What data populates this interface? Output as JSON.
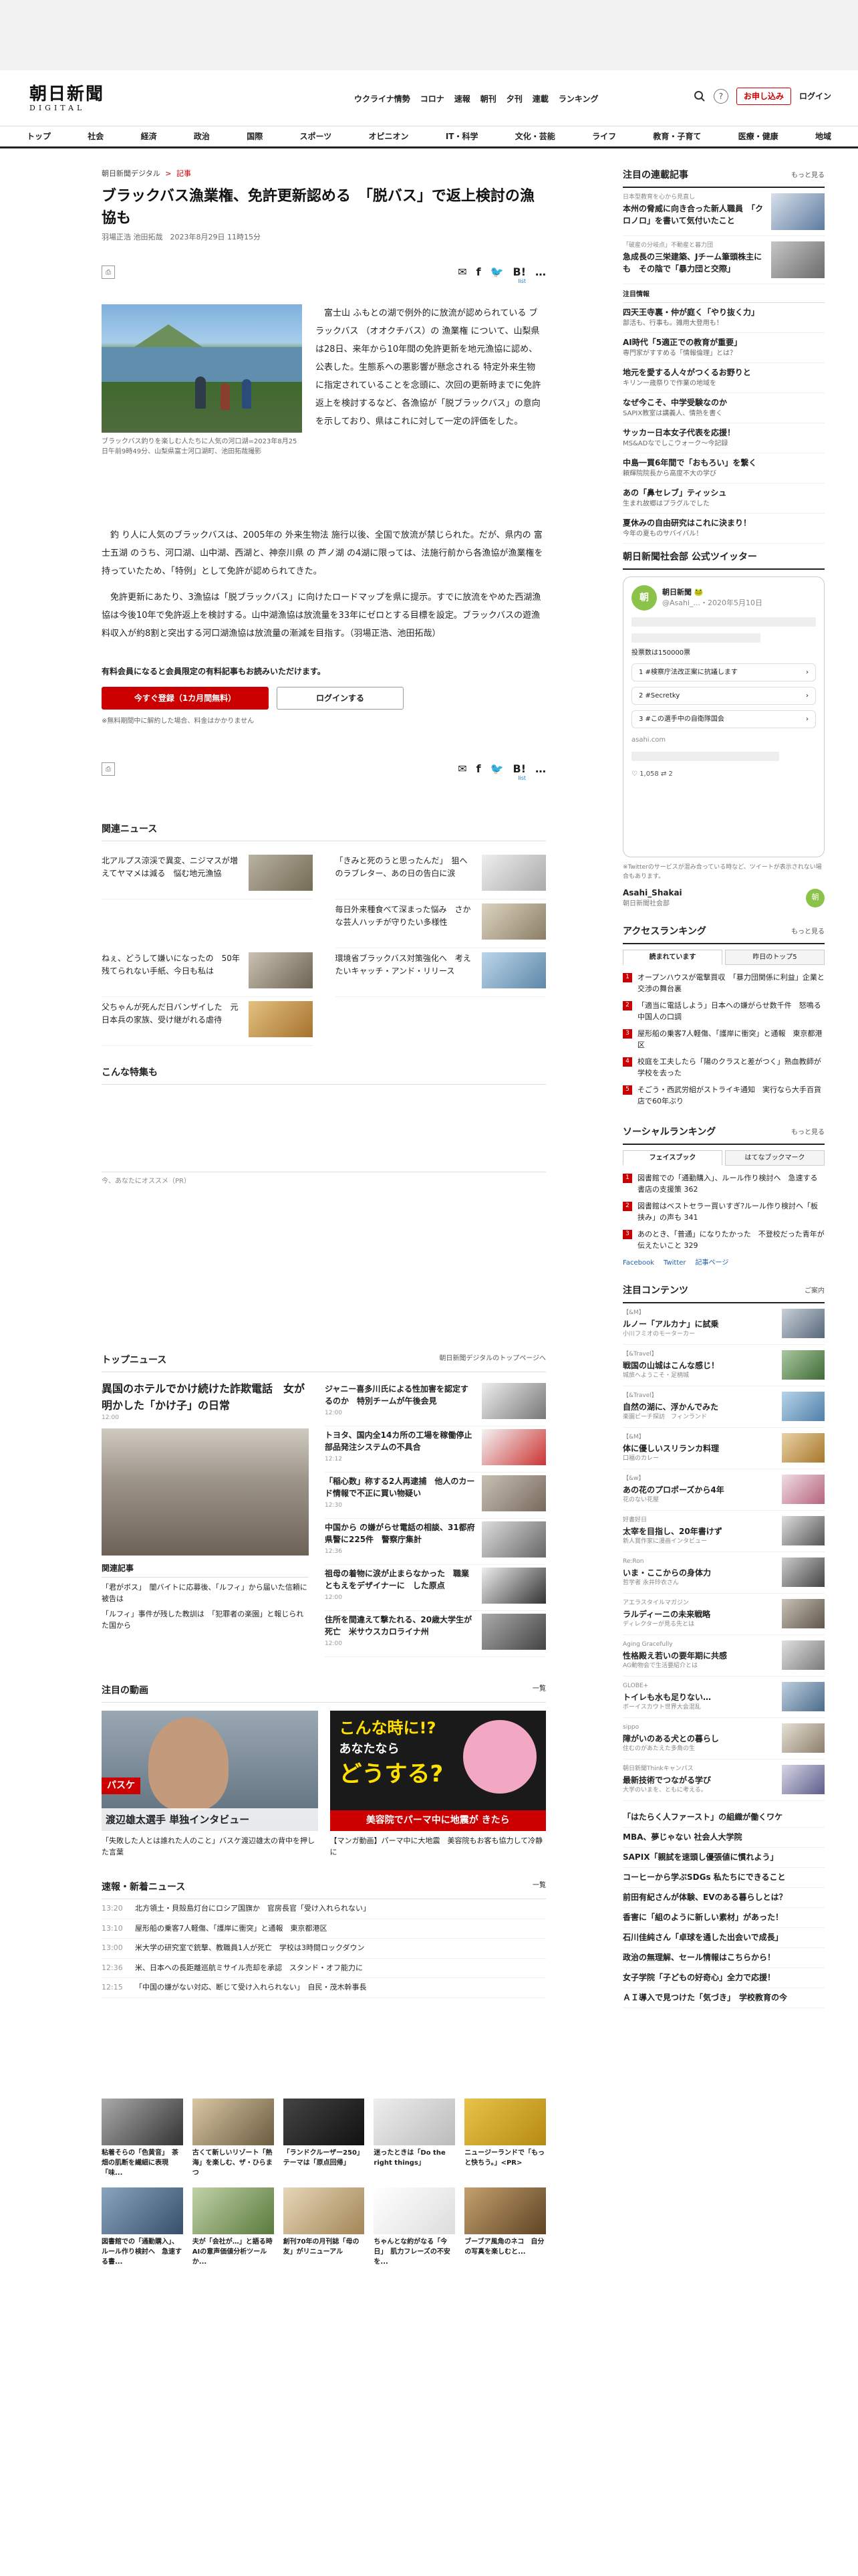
{
  "header": {
    "logo_jp": "朝日新聞",
    "logo_en": "DIGITAL",
    "nav": [
      "ウクライナ情勢",
      "コロナ",
      "速報",
      "朝刊",
      "夕刊",
      "連載",
      "ランキング"
    ],
    "register": "お申し込み",
    "login": "ログイン",
    "search_icon": "search-icon",
    "help": "?"
  },
  "categories": [
    "トップ",
    "社会",
    "経済",
    "政治",
    "国際",
    "スポーツ",
    "オピニオン",
    "IT・科学",
    "文化・芸能",
    "ライフ",
    "教育・子育て",
    "医療・健康",
    "地域"
  ],
  "article": {
    "crumb_site": "朝日新聞デジタル",
    "crumb_sep": ">",
    "crumb_cat": "記事",
    "title": "ブラックバス漁業権、免許更新認める　「脱バス」で返上検討の漁協も",
    "byline": "羽場正浩 池田拓哉　2023年8月29日 11時15分",
    "list_label": "list",
    "caption": "ブラックバス釣りを楽しむ人たちに人気の河口湖=2023年8月25日午前9時49分、山梨県富士河口湖町、池田拓哉撮影",
    "p1": "富士山 ふもとの湖で例外的に放流が認められている ブラックバス （オオクチバス）の 漁業権 について、山梨県 は28日、来年から10年間の免許更新を地元漁協に認め、公表した。生態系への悪影響が懸念される 特定外来生物 に指定されていることを念頭に、次回の更新時までに免許返上を検討するなど、各漁協が「脱ブラックバス」の意向を示しており、県はこれに対して一定の評価をした。",
    "p2": "釣 り人に人気のブラックバスは、2005年の 外来生物法 施行以後、全国で放流が禁じられた。だが、県内の 富士五湖 のうち、河口湖、山中湖、西湖と、神奈川県 の 芦ノ湖 の4湖に限っては、法施行前から各漁協が漁業権を持っていたため、「特例」として免許が認められてきた。",
    "p3": "免許更新にあたり、3漁協は「脱ブラックバス」に向けたロードマップを県に提示。すでに放流をやめた西湖漁協は今後10年で免許返上を検討する。山中湖漁協は放流量を33年にゼロとする目標を設定。ブラックバスの遊漁料収入が約8割と突出する河口湖漁協は放流量の漸減を目指す。（羽場正浩、池田拓哉）",
    "member": "有料会員になると会員限定の有料記事もお読みいただけます。",
    "btn_signup": "今すぐ登録（1カ月間無料）",
    "btn_login": "ログインする",
    "note": "※無料期間中に解約した場合、料金はかかりません",
    "share_bang": "B!",
    "more_dots": "…"
  },
  "related": {
    "heading": "関連ニュース",
    "items": [
      "北アルプス涼渓で異変、ニジマスが増えてヤマメは減る　悩む地元漁協",
      "「きみと死のうと思ったんだ」　狙へのラブレター、あの日の告白に涙",
      "",
      "毎日外来種食べて深まった悩み　さかな芸人ハッチが守りたい多様性",
      "ねぇ、どうして嫌いになったの　50年残てられない手紙、今日も私は",
      "環境省ブラックバス対策強化へ　考えたいキャッチ・アンド・リリース",
      "父ちゃんが死んだ日バンザイした　元日本兵の家族、受け継がれる虐待",
      ""
    ]
  },
  "feature_heading": "こんな特集も",
  "pr_label": "今、あなたにオススメ（PR）",
  "topnews": {
    "heading": "トップニュース",
    "more": "朝日新聞デジタルのトップページへ",
    "lead_title": "異国のホテルでかけ続けた詐欺電話　女が明かした「かけ子」の日常",
    "lead_time": "12:00",
    "rel_head": "関連記事",
    "rel": [
      "「君がボス」　闇バイトに応募後、「ルフィ」から届いた信頼に被告は",
      "「ルフィ」事件が残した教訓は　「犯罪者の楽園」と報じられた国から"
    ],
    "items": [
      {
        "t": "ジャニー喜多川氏による性加害を認定するのか　特別チームが午後会見",
        "tm": "12:00"
      },
      {
        "t": "トヨタ、国内全14カ所の工場を稼働停止　部品発注システムの不具合",
        "tm": "12:12"
      },
      {
        "t": "「稲心数」称する2人再逮捕　他人のカード情報で不正に買い物疑い",
        "tm": "12:30"
      },
      {
        "t": "中国から の嫌がらせ電話の相談、31都府県警に225件　警察庁集計",
        "tm": "12:36"
      },
      {
        "t": "祖母の着物に涙が止まらなかった　職業ともえをデザイナーに　した原点",
        "tm": "12:00"
      },
      {
        "t": "住所を間違えて撃たれる、20歳大学生が死亡　米サウスカロライナ州",
        "tm": "12:00"
      }
    ]
  },
  "video": {
    "heading": "注目の動画",
    "more": "一覧",
    "v1_label": "パスケ",
    "v1_caption": "渡辺雄太選手 単独インタビュー",
    "v1_title": "「失敗した人とは誰れた人のこと」バスケ渡辺雄太の背中を押した言葉",
    "v2_top": "こんな時に!?",
    "v2_mid": "あなたなら",
    "v2_big": "どうする?",
    "v2_band": "美容院でパーマ中に地震が きたら",
    "v2_title": "【マンガ動画】パーマ中に大地震　美容院もお客も協力して冷静に"
  },
  "flash": {
    "heading": "速報・新着ニュース",
    "more": "一覧",
    "items": [
      {
        "tm": "13:20",
        "t": "北方領土・貝殻島灯台にロシア国旗か　官房長官「受け入れられない」"
      },
      {
        "tm": "13:10",
        "t": "屋形船の乗客7人軽傷、「護岸に衝突」と通報　東京都港区"
      },
      {
        "tm": "13:00",
        "t": "米大学の研究室で銃撃、教職員1人が死亡　学校は3時間ロックダウン"
      },
      {
        "tm": "12:36",
        "t": "米、日本への長距離巡航ミサイル売却を承認　スタンド・オフ能力に"
      },
      {
        "tm": "12:15",
        "t": "「中国の嫌がない対応、断じて受け入れられない」　自民・茂木幹事長"
      }
    ]
  },
  "bottom": [
    {
      "t": "粘着そらの「色黄音」　茶畑の肌断を繊細に表現　「味..."
    },
    {
      "t": "古くて新しいリゾート「熱海」を楽しむ、ザ・ひらまつ"
    },
    {
      "t": "「ランドクルーザー250」　テーマは「原点回帰」"
    },
    {
      "t": "迷ったときは「Do the right things」"
    },
    {
      "t": "ニュージーランドで「もっと快ちう。」<PR>"
    },
    {
      "t": "図書館での「通勤購入」、ルール作り検討へ　急速する書..."
    },
    {
      "t": "夫が「会社が…」と語る時　AIの意声価値分析ツールか..."
    },
    {
      "t": "創刊70年の月刊誌「母の友」がリニューアル"
    },
    {
      "t": "ちゃんとな約がなる「今日」　肌力フレーズの不安を..."
    },
    {
      "t": "ブーブア風角のネコ　自分の写真を楽しむと..."
    }
  ],
  "side": {
    "serial_head": "注目の連載記事",
    "serial_more": "もっと見る",
    "serials": [
      {
        "lb": "日本型教育を心から見直し",
        "t": "本州の脅威に向き合った新人職員　「クロノロ」を書いて気付いたこと"
      },
      {
        "lb": "「破産の分岐点」不動産と暮力団",
        "t": "急成長の三栄建築、Jチーム筆頭株主にも　その陰で「暴力団と交際」"
      },
      {
        "lb": "",
        "t": "注目情報"
      }
    ],
    "topics": [
      {
        "t": "四天王寺裏・仲が庭く「やり抜く力」",
        "s": "部活も、行事も。雑用大登用も！"
      },
      {
        "t": "AI時代「5適正での教育が重要」",
        "s": "専門家がすすめる「情報倫理」とは？"
      },
      {
        "t": "地元を愛する人々がつくるお野りと",
        "s": "キリン一歳祭りで作業の地域を"
      },
      {
        "t": "なぜ今こそ、中学受験なのか",
        "s": "SAPIX教室は講義人、情熱を書く"
      },
      {
        "t": "サッカー日本女子代表を応援！",
        "s": "MS&ADなでしこウォーク〜今記録"
      },
      {
        "t": "中島一買6年間で「おもろい」を繋く",
        "s": "頼輝院院長から高度不大の学び"
      },
      {
        "t": "あの「鼻セレブ」ティッシュ",
        "s": "生まれ故郷はプラグルでした"
      },
      {
        "t": "夏休みの自由研究はこれに決まり！",
        "s": "今年の夏ものサバイバル！"
      }
    ],
    "twitter_head": "朝日新聞社会部 公式ツイッター",
    "tw_name": "朝日新聞 🐸",
    "tw_handle": "@Asahi_...",
    "tw_date": "・2020年5月10日",
    "tw_count": "投票数は150000票",
    "tw_opts": [
      "1 #検察庁法改正案に抗議します",
      "2 #Secretky",
      "3 #この選手中の自衛隊国会"
    ],
    "tw_domain": "asahi.com",
    "tw_likes": "1,058",
    "tw_rt": "2",
    "tw_note": "※Twitterのサービスが混み合っている時など、ツイートが表示されない場合もあります。",
    "tw_account": "Asahi_Shakai",
    "tw_account_sub": "朝日新聞社会部",
    "rank_head": "アクセスランキング",
    "rank_more": "もっと見る",
    "rank_tabs": [
      "読まれています",
      "昨日のトップ5"
    ],
    "ranks": [
      "オープンハウスが電撃買収　「暴力団関係に利益」企業と交渉の舞台裏",
      "「適当に電話しよう」日本への嫌がらせ数千件　怒鳴る中国人の口調",
      "屋形船の乗客7人軽傷、「護岸に衝突」と通報　東京都港区",
      "校庭を工夫したら「陽のクラスと差がつく」熟血教師が学校を去った",
      "そごう・西武労組がストライキ通知　実行なら大手百貨店で60年ぶり"
    ],
    "social_head": "ソーシャルランキング",
    "social_more": "もっと見る",
    "social_tabs": [
      "フェイスブック",
      "はてなブックマーク"
    ],
    "socials": [
      "図書館での「通勤購入」、ルール作り検討へ　急速する書店の支援策 362",
      "図書館はベストセラー買いすぎ?ルール作り検討へ「板挟み」の声も 341",
      "あのとき、「普通」になりたかった　不登校だった青年が伝えたいこと 329"
    ],
    "share_row": [
      "Facebook",
      "Twitter",
      "記事ページ"
    ],
    "attention_head": "注目コンテンツ",
    "attention_more": "ご案内",
    "attentions": [
      {
        "lb": "【&M】",
        "t": "ルノー「アルカナ」に試乗",
        "s": "小川フミオのモーターカー"
      },
      {
        "lb": "【&Travel】",
        "t": "戦国の山城はこんな感じ！",
        "s": "城旅へようこそ・足柄城"
      },
      {
        "lb": "【&Travel】",
        "t": "自然の湖に、浮かんでみた",
        "s": "楽園ビーチ探訪　フィンランド"
      },
      {
        "lb": "【&M】",
        "t": "体に優しいスリランカ料理",
        "s": "口福のカレー"
      },
      {
        "lb": "【&w】",
        "t": "あの花のプロポーズから4年",
        "s": "花のない花屋"
      },
      {
        "lb": "好書好日",
        "t": "太宰を目指し、20年書けず",
        "s": "新人賞作家に漫画インタビュー"
      },
      {
        "lb": "Re:Ron",
        "t": "いま・ここからの身体力",
        "s": "哲学者 永井玲衣さん"
      },
      {
        "lb": "アエラスタイルマガジン",
        "t": "ラルディーニの未来戦略",
        "s": "ディレクターが見る先とは"
      },
      {
        "lb": "Aging Gracefully",
        "t": "性格殿え若いの要年期に共感",
        "s": "AG動物会で生活要紹介とは"
      },
      {
        "lb": "GLOBE+",
        "t": "トイレも水も足りない…",
        "s": "ボーイスカウト世界大会混乱"
      },
      {
        "lb": "sippo",
        "t": "障がいのある犬との暮らし",
        "s": "住むのがあたえた多角の生"
      },
      {
        "lb": "朝日新聞Thinkキャンパス",
        "t": "最新技術でつながる学び",
        "s": "大学のいまを、ともに考える。"
      }
    ],
    "links": [
      "「はたらく人ファースト」の組織が働くワケ",
      "MBA、夢じゃない 社会人大学院",
      "SAPIX「親試を速頭し優張値に慣れよう」",
      "コーヒーから学ぶSDGs 私たちにできること",
      "前田有紀さんが体験、EVのある暮らしとは？",
      "香害に「組のように新しい素材」があった！",
      "石川佳純さん「卓球を通した出会いで成長」",
      "政治の無理解、セール情報はこちらから！",
      "女子学院「子どもの好奇心」全力で応援！",
      "ＡＩ導入で見つけた「気づき」　学校教育の今"
    ]
  },
  "colors": {
    "brand_red": "#cc0000",
    "rank_red": "#cc0000"
  }
}
